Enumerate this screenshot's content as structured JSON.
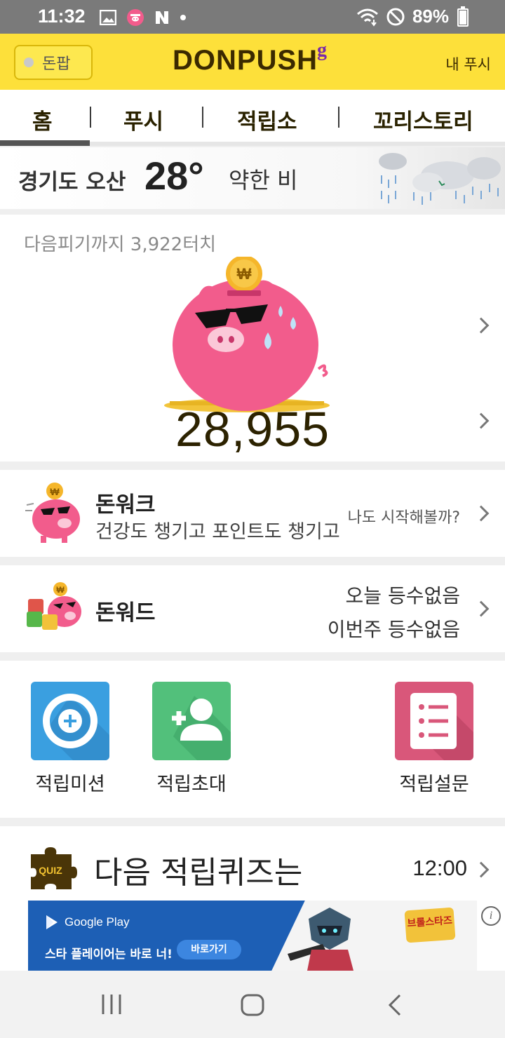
{
  "status_bar": {
    "time": "11:32",
    "battery_text": "89%",
    "battery_level": 0.89
  },
  "app_bar": {
    "donpop_label": "돈팝",
    "logo": "DONPUSH",
    "logo_suffix": "g",
    "my_push": "내 푸시"
  },
  "tabs": [
    "홈",
    "푸시",
    "적립소",
    "꼬리스토리"
  ],
  "active_tab": 0,
  "weather": {
    "location": "경기도 오산",
    "temperature": "28°",
    "condition": "약한 비"
  },
  "piggy": {
    "touch_text": "다음피기까지 3,922터치",
    "points": "28,955"
  },
  "donwalk": {
    "title": "돈워크",
    "subtitle": "건강도 챙기고 포인트도 챙기고",
    "right_text": "나도 시작해볼까?"
  },
  "donword": {
    "title": "돈워드",
    "today_rank": "오늘 등수없음",
    "week_rank": "이번주 등수없음"
  },
  "shortcuts": [
    {
      "label": "적립미션",
      "color": "#3a9fe0"
    },
    {
      "label": "적립초대",
      "color": "#52c07b"
    },
    {
      "label": "적립설문",
      "color": "#d9577a"
    }
  ],
  "quiz": {
    "icon_text": "QUIZ",
    "title": "다음 적립퀴즈는",
    "time": "12:00"
  },
  "ad": {
    "store": "Google Play",
    "text": "스타 플레이어는 바로 너!",
    "button": "바로가기",
    "game_logo": "브롤스타즈",
    "info": "i"
  },
  "colors": {
    "brand_yellow": "#fde03a",
    "brand_brown": "#3b2a00",
    "pig_pink": "#f25c8c"
  }
}
